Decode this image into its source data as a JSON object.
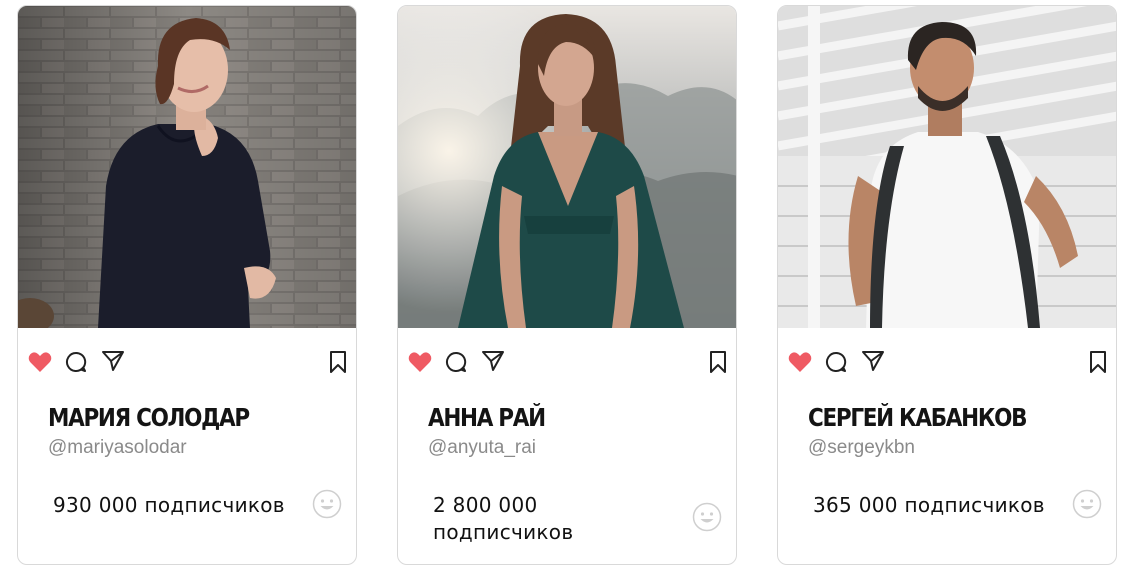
{
  "cards": [
    {
      "name": "МАРИЯ СОЛОДАР",
      "handle": "@mariyasolodar",
      "followers": "930 000 подписчиков",
      "photo": "woman-in-black-sweater-portrait",
      "liked": true
    },
    {
      "name": "АННА РАЙ",
      "handle": "@anyuta_rai",
      "followers": "2 800 000 подписчиков",
      "photo": "woman-in-green-dress-portrait",
      "liked": true
    },
    {
      "name": "СЕРГЕЙ КАБАНКОВ",
      "handle": "@sergeykbn",
      "followers": "365 000 подписчиков",
      "photo": "man-in-white-tshirt-with-backpack-portrait",
      "liked": true
    }
  ],
  "icons": [
    "heart-icon",
    "comment-icon",
    "share-icon",
    "bookmark-icon",
    "smiley-icon"
  ],
  "colors": {
    "like": "#ef5a63",
    "text": "#141414",
    "muted": "#8a8a8a",
    "border": "#d9d9d9"
  }
}
